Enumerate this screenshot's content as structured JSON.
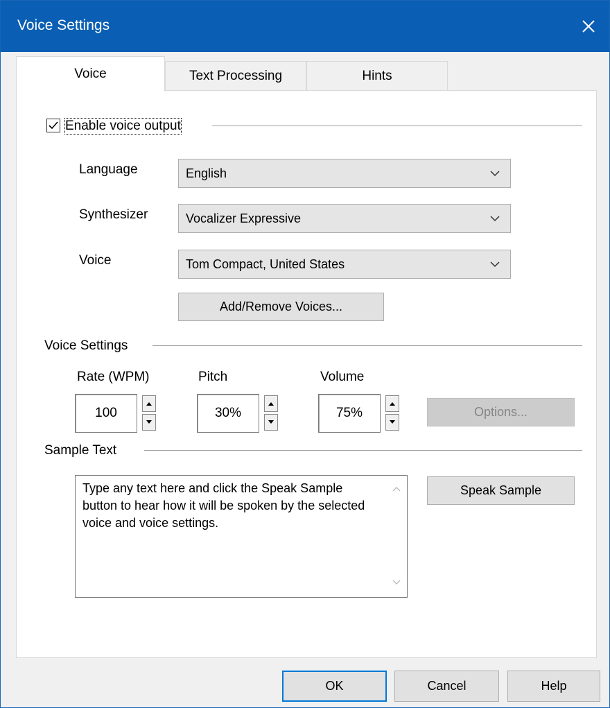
{
  "window": {
    "title": "Voice Settings"
  },
  "tabs": [
    {
      "label": "Voice",
      "active": true
    },
    {
      "label": "Text Processing",
      "active": false
    },
    {
      "label": "Hints",
      "active": false
    }
  ],
  "enable_voice": {
    "label": "Enable voice output",
    "checked": true
  },
  "fields": {
    "language": {
      "label": "Language",
      "value": "English"
    },
    "synthesizer": {
      "label": "Synthesizer",
      "value": "Vocalizer Expressive"
    },
    "voice": {
      "label": "Voice",
      "value": "Tom Compact, United States"
    }
  },
  "add_remove_label": "Add/Remove Voices...",
  "voice_settings": {
    "heading": "Voice Settings",
    "rate": {
      "label": "Rate (WPM)",
      "value": "100"
    },
    "pitch": {
      "label": "Pitch",
      "value": "30%"
    },
    "volume": {
      "label": "Volume",
      "value": "75%"
    },
    "options_label": "Options..."
  },
  "sample": {
    "heading": "Sample Text",
    "text": "Type any text here and click the Speak Sample button to hear how it will be spoken by the selected voice and voice settings.",
    "speak_button": "Speak Sample"
  },
  "footer": {
    "ok": "OK",
    "cancel": "Cancel",
    "help": "Help"
  },
  "colors": {
    "titlebar": "#0a5fb4",
    "focus_border": "#0078d7"
  }
}
